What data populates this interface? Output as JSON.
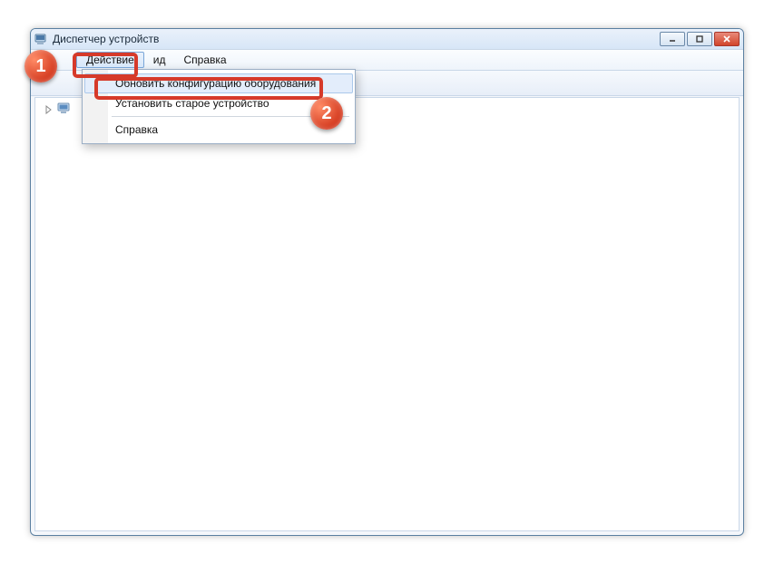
{
  "window": {
    "title": "Диспетчер устройств"
  },
  "menubar": {
    "action": "Действие",
    "view_suffix": "ид",
    "help": "Справка"
  },
  "dropdown": {
    "scan_hardware": "Обновить конфигурацию оборудования",
    "add_legacy": "Установить старое устройство",
    "help": "Справка"
  },
  "callouts": {
    "one": "1",
    "two": "2"
  }
}
